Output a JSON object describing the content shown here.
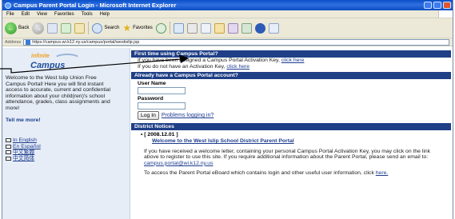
{
  "window": {
    "title": "Campus Parent Portal Login - Microsoft Internet Explorer"
  },
  "menu": [
    "File",
    "Edit",
    "View",
    "Favorites",
    "Tools",
    "Help"
  ],
  "toolbar": {
    "back_label": "Back",
    "search_label": "Search",
    "favorites_label": "Favorites"
  },
  "address": {
    "label": "Address",
    "url": "https://campus.wi.k12.ny.us/campus/portal/westislip.jsp"
  },
  "sidebar": {
    "logo_top": "infinite",
    "logo_main": "Campus",
    "welcome": "Welcome to the West Islip Union Free Campus Portal! Here you will find instant access to accurate, current and confidential information about your child(ren)'s school attendance, grades, class assignments and more!",
    "tell_more": "Tell me more!",
    "languages": [
      "In English",
      "En Español",
      "中文繁體",
      "中文简体"
    ]
  },
  "first_time": {
    "header": "First time using Campus Portal?",
    "line1_text": "If you have been assigned a Campus Portal Activation Key, ",
    "line1_link": "click here",
    "line2_text": "If you do not have an Activation Key, ",
    "line2_link": "click here"
  },
  "account": {
    "header": "Already have a Campus Portal account?",
    "username_label": "User Name",
    "password_label": "Password",
    "login_button": "Log In",
    "problems_link": "Problems logging in?"
  },
  "notices": {
    "header": "District Notices",
    "date": "[ 2008.12.01 ]",
    "title": "Welcome to the West Islip School District Parent Portal",
    "paragraph1_text": "If you have received a welcome letter, containing your personal Campus Portal Activation Key, you may click on the link above to register to use this site. If you require additional information about the Parent Portal, please send an email to: ",
    "paragraph1_link": "campus.portal@wi.k12.ny.us",
    "paragraph2_text": "To access the Parent Portal eBoard which contains login and other useful user information, click ",
    "paragraph2_link": "here."
  }
}
